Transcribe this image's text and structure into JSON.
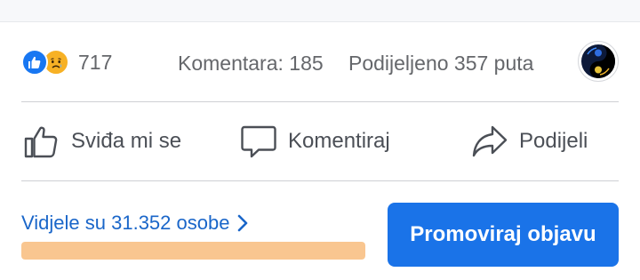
{
  "stats": {
    "reactions": [
      "like-icon",
      "sad-icon"
    ],
    "reaction_count": "717",
    "comments": "Komentara: 185",
    "shares": "Podijeljeno 357 puta"
  },
  "actions": {
    "like_label": "Sviđa mi se",
    "comment_label": "Komentiraj",
    "share_label": "Podijeli"
  },
  "insights": {
    "views_text": "Vidjele su 31.352 osobe",
    "progress": 1.0
  },
  "promote": {
    "label": "Promoviraj objavu"
  },
  "colors": {
    "like_blue": "#1877f2",
    "link_blue": "#1a66c9",
    "button_blue": "#1a73e8",
    "progress_fill": "#f9c690",
    "text_gray": "#65676b"
  }
}
